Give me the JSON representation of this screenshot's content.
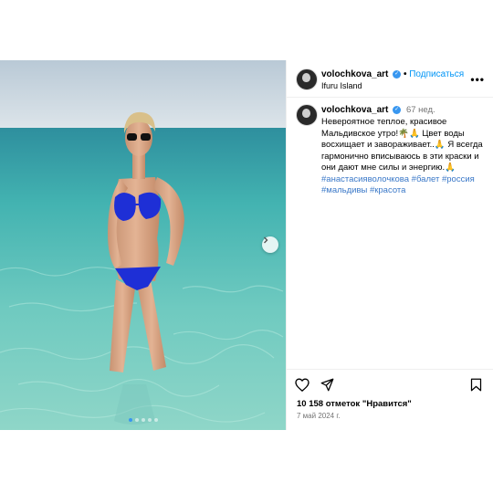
{
  "post": {
    "username": "volochkova_art",
    "separator": "•",
    "follow_label": "Подписаться",
    "location": "Ifuru Island",
    "more_label": "•••"
  },
  "caption": {
    "username": "volochkova_art",
    "time_ago": "67 нед.",
    "text": "Невероятное теплое, красивое Мальдивское утро!🌴🙏 Цвет воды восхищает и завораживает..🙏 Я всегда гармонично вписываюсь в эти краски и они дают мне силы и энергию.🙏",
    "hashtags": "#анастасияволочкова #балет #россия #мальдивы #красота"
  },
  "footer": {
    "likes": "10 158 отметок \"Нравится\"",
    "date": "7 май 2024 г."
  },
  "carousel": {
    "count": 5,
    "active_index": 0
  },
  "colors": {
    "accent": "#0095f6",
    "active_dot": "#3a96f0",
    "water": "#4fb6b0",
    "bikini": "#1e2fd6"
  },
  "icons": [
    "more-icon",
    "verified-icon",
    "next-icon",
    "heart-icon",
    "share-icon",
    "bookmark-icon"
  ]
}
